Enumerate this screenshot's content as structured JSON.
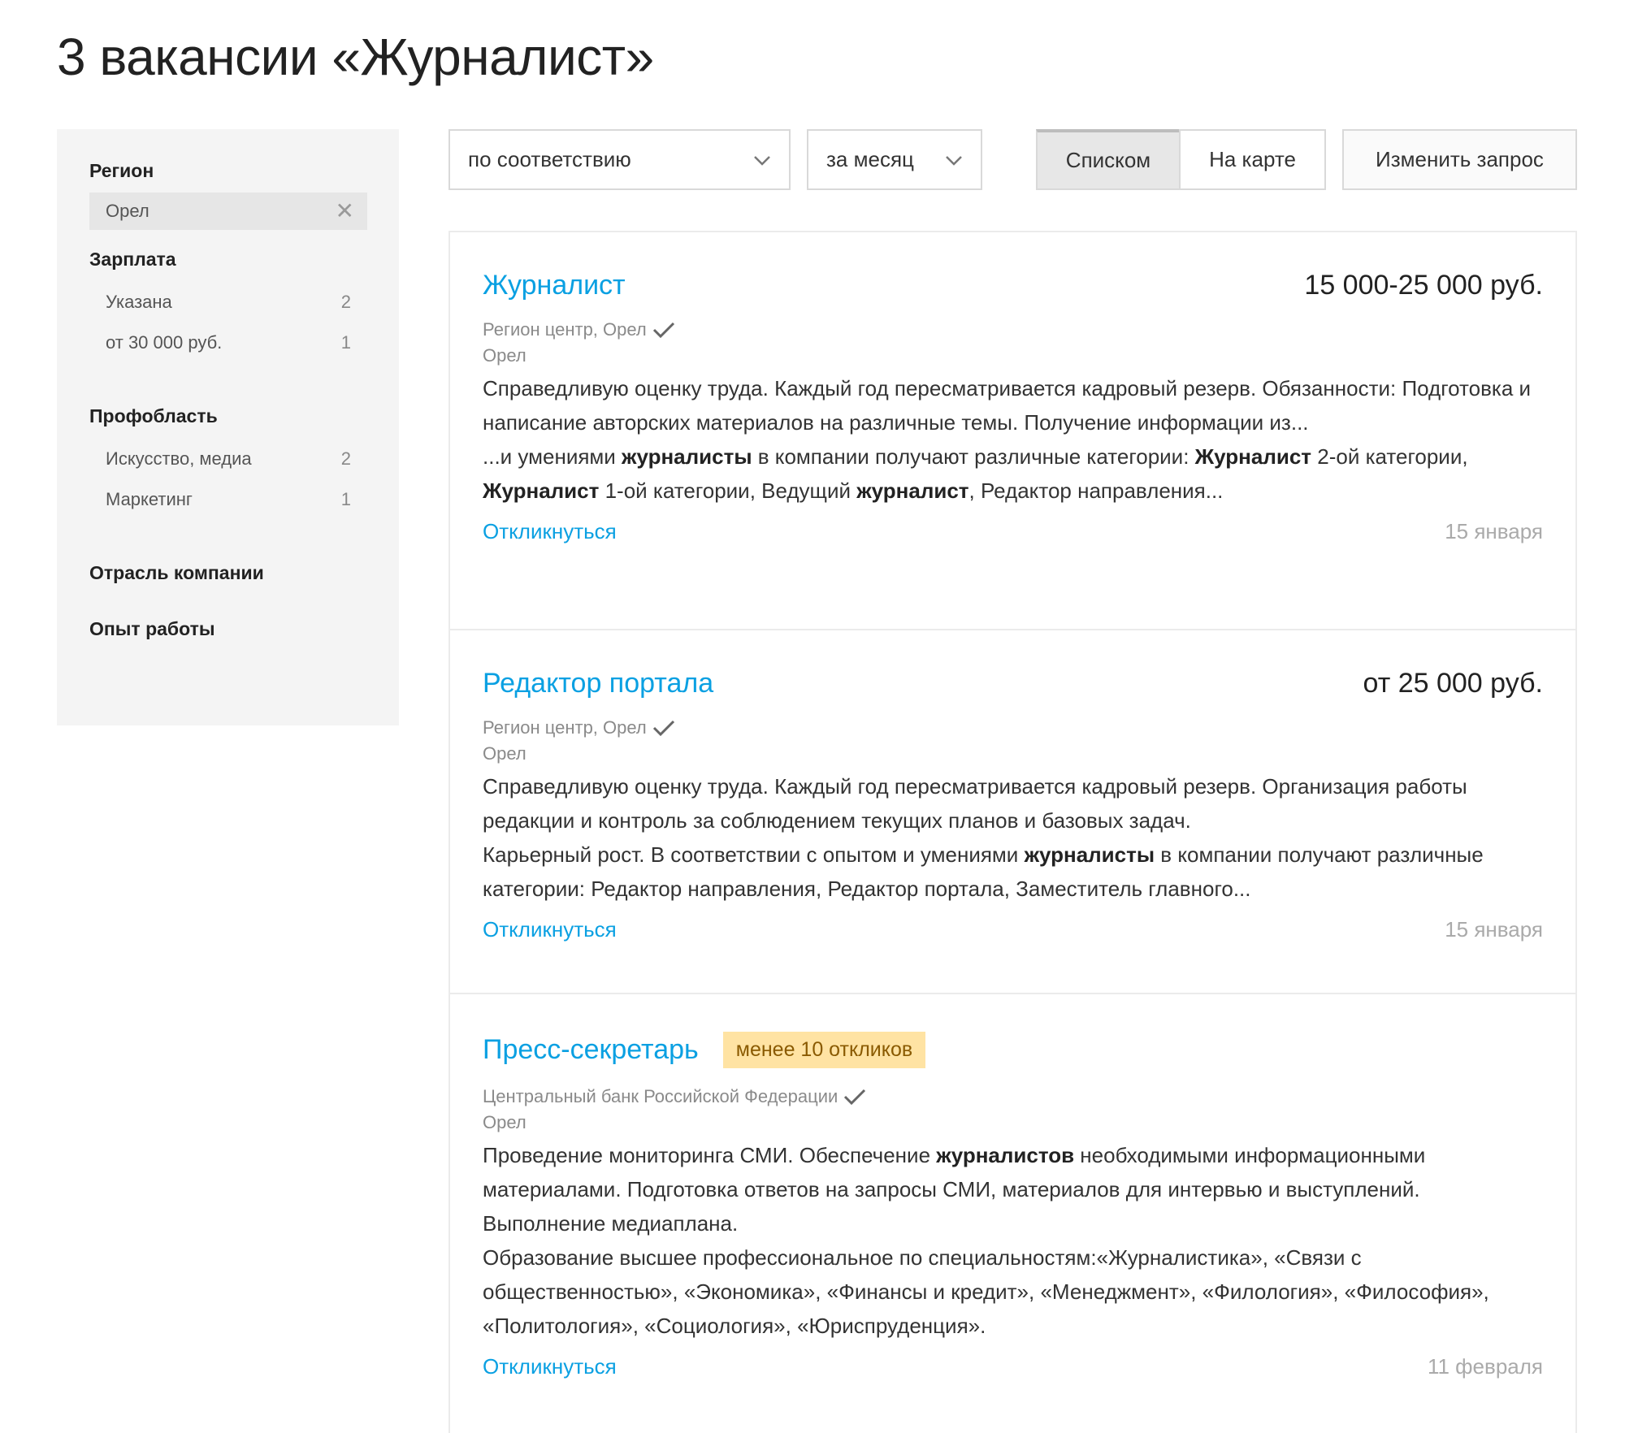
{
  "page_title": "3 вакансии «Журналист»",
  "sidebar": {
    "region": {
      "heading": "Регион",
      "chip": "Орел"
    },
    "salary": {
      "heading": "Зарплата",
      "items": [
        {
          "label": "Указана",
          "count": "2"
        },
        {
          "label": "от 30 000 руб.",
          "count": "1"
        }
      ]
    },
    "prof": {
      "heading": "Профобласть",
      "items": [
        {
          "label": "Искусство, медиа",
          "count": "2"
        },
        {
          "label": "Маркетинг",
          "count": "1"
        }
      ]
    },
    "industry": {
      "heading": "Отрасль компании"
    },
    "experience": {
      "heading": "Опыт работы"
    }
  },
  "toolbar": {
    "sort": "по соответствию",
    "period": "за месяц",
    "view_list": "Списком",
    "view_map": "На карте",
    "change_query": "Изменить запрос"
  },
  "vacancies": [
    {
      "title": "Журналист",
      "salary": "15 000-25 000 руб.",
      "company": "Регион центр, Орел",
      "city": "Орел",
      "desc": [
        [
          {
            "t": "Справедливую оценку труда. Каждый год пересматривается кадровый резерв. Обязанности: Подготовка и написание авторских материалов на различные темы. Получение информации из..."
          }
        ],
        [
          {
            "t": "...и умениями "
          },
          {
            "t": "журналисты",
            "b": true
          },
          {
            "t": " в компании получают различные категории: "
          },
          {
            "t": "Журналист",
            "b": true
          },
          {
            "t": " 2-ой категории, "
          },
          {
            "t": "Журналист",
            "b": true
          },
          {
            "t": " 1-ой категории, Ведущий "
          },
          {
            "t": "журналист",
            "b": true
          },
          {
            "t": ", Редактор направления..."
          }
        ]
      ],
      "respond": "Откликнуться",
      "date": "15 января"
    },
    {
      "title": "Редактор портала",
      "salary": "от 25 000 руб.",
      "company": "Регион центр, Орел",
      "city": "Орел",
      "desc": [
        [
          {
            "t": "Справедливую оценку труда. Каждый год пересматривается кадровый резерв. Организация работы редакции и контроль за соблюдением текущих планов и базовых задач."
          }
        ],
        [
          {
            "t": "Карьерный рост. В соответствии с опытом и умениями "
          },
          {
            "t": "журналисты",
            "b": true
          },
          {
            "t": " в компании получают различные категории: Редактор направления, Редактор портала, Заместитель главного..."
          }
        ]
      ],
      "respond": "Откликнуться",
      "date": "15 января"
    },
    {
      "title": "Пресс-секретарь",
      "badge": "менее 10 откликов",
      "company": "Центральный банк Российской Федерации",
      "city": "Орел",
      "desc": [
        [
          {
            "t": "Проведение мониторинга СМИ. Обеспечение "
          },
          {
            "t": "журналистов",
            "b": true
          },
          {
            "t": " необходимыми информационными материалами. Подготовка ответов на запросы СМИ, материалов для интервью и выступлений. Выполнение медиаплана."
          }
        ],
        [
          {
            "t": "Образование высшее профессиональное по специальностям:«Журналистика», «Связи с общественностью», «Экономика», «Финансы и кредит», «Менеджмент», «Филология», «Философия», «Политология», «Социология», «Юриспруденция»."
          }
        ]
      ],
      "respond": "Откликнуться",
      "date": "11 февраля"
    }
  ],
  "colors": {
    "link": "#0aa0e2",
    "badge_bg": "#ffe3a3",
    "sidebar_bg": "#f4f4f4"
  }
}
